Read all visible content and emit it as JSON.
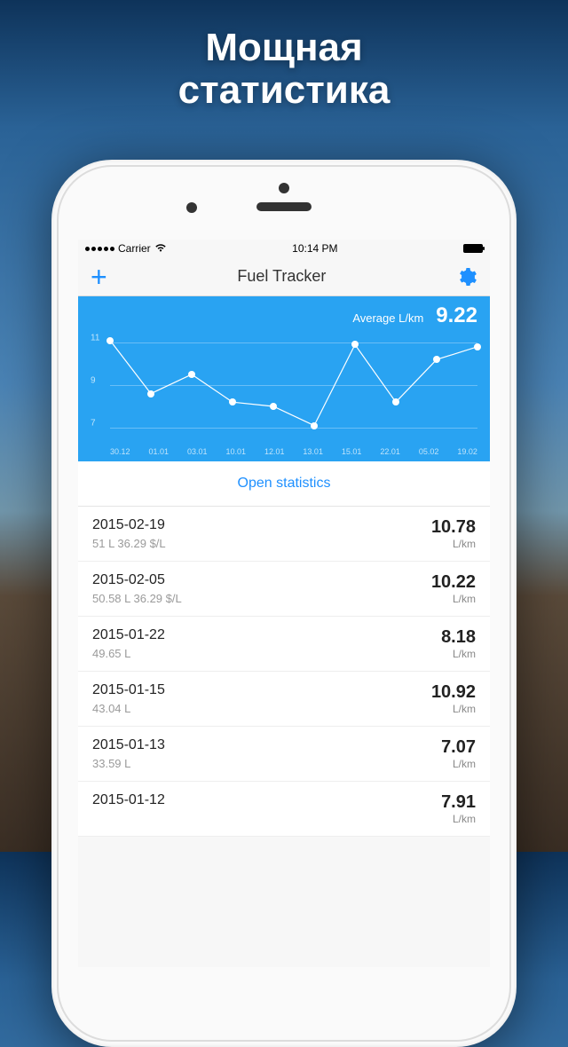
{
  "promo": {
    "line1": "Мощная",
    "line2": "статистика"
  },
  "status": {
    "carrier": "Carrier",
    "time": "10:14 PM"
  },
  "nav": {
    "title": "Fuel Tracker"
  },
  "chart": {
    "avg_label": "Average L/km",
    "avg_value": "9.22"
  },
  "chart_data": {
    "type": "line",
    "categories": [
      "30.12",
      "01.01",
      "03.01",
      "10.01",
      "12.01",
      "13.01",
      "15.01",
      "22.01",
      "05.02",
      "19.02"
    ],
    "values": [
      11.1,
      8.6,
      9.5,
      8.2,
      8.0,
      7.1,
      10.9,
      8.2,
      10.2,
      10.8
    ],
    "ylabel_ticks": [
      7,
      9,
      11
    ],
    "ylim": [
      6.5,
      11.5
    ],
    "title": "",
    "xlabel": "",
    "ylabel": ""
  },
  "open_label": "Open statistics",
  "unit": "L/km",
  "entries": [
    {
      "date": "2015-02-19",
      "sub": "51 L    36.29 $/L",
      "value": "10.78"
    },
    {
      "date": "2015-02-05",
      "sub": "50.58 L    36.29 $/L",
      "value": "10.22"
    },
    {
      "date": "2015-01-22",
      "sub": "49.65 L",
      "value": "8.18"
    },
    {
      "date": "2015-01-15",
      "sub": "43.04 L",
      "value": "10.92"
    },
    {
      "date": "2015-01-13",
      "sub": "33.59 L",
      "value": "7.07"
    },
    {
      "date": "2015-01-12",
      "sub": "",
      "value": "7.91"
    }
  ]
}
